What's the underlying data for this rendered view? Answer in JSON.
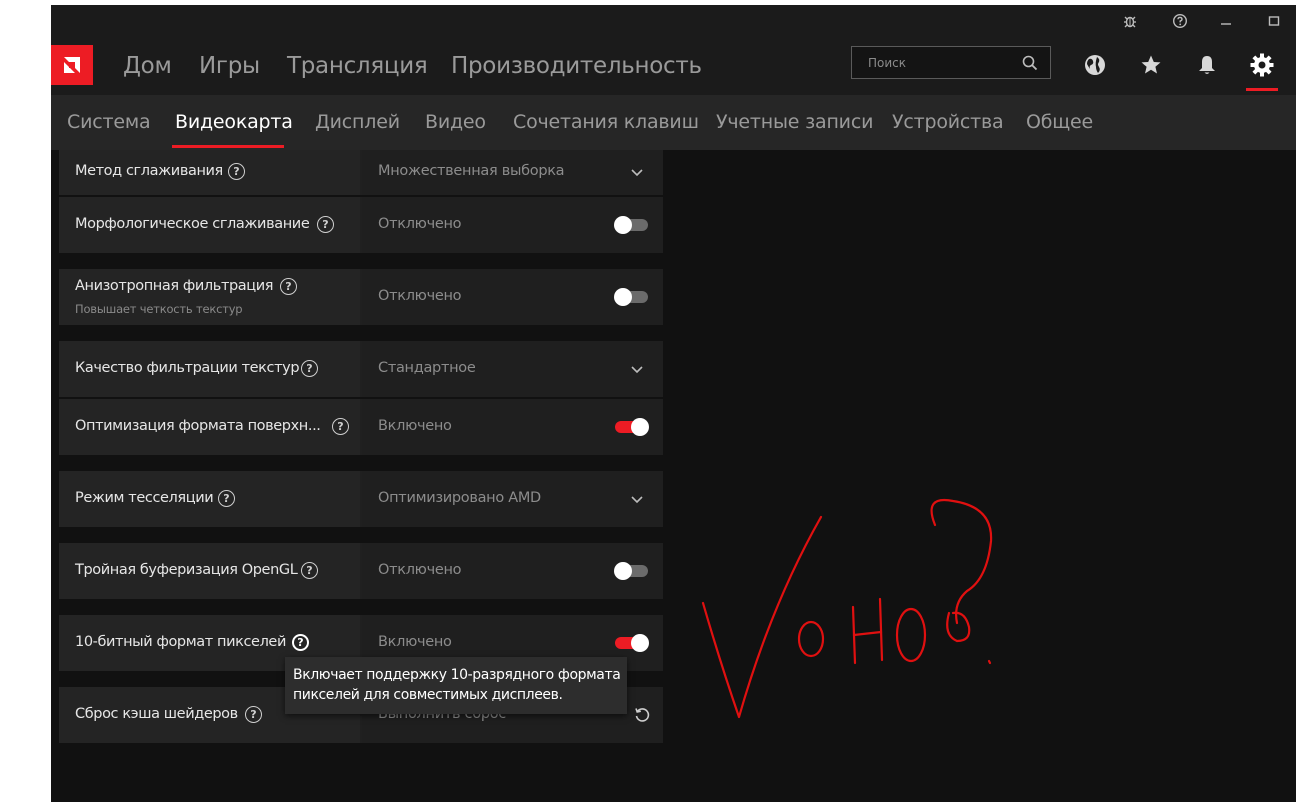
{
  "colors": {
    "accent": "#ed1c24",
    "background": "#111111",
    "row_label_bg": "#242424",
    "row_value_bg": "#1f1f1f",
    "scribble": "#e01010"
  },
  "titlebar": {
    "icons": [
      "bug-icon",
      "help-icon",
      "minimize-icon",
      "maximize-icon"
    ]
  },
  "mainnav": {
    "logo_icon": "amd-logo-icon",
    "items": [
      "Дом",
      "Игры",
      "Трансляция",
      "Производительность"
    ],
    "search_placeholder": "Поиск",
    "right_icons": [
      "globe-icon",
      "star-icon",
      "bell-icon",
      "gear-icon"
    ]
  },
  "subnav": {
    "items": [
      "Система",
      "Видеокарта",
      "Дисплей",
      "Видео",
      "Сочетания клавиш",
      "Учетные записи",
      "Устройства",
      "Общее"
    ],
    "active": "Видеокарта"
  },
  "settings": [
    {
      "label": "Метод сглаживания",
      "value": "Множественная выборка",
      "control": "dropdown"
    },
    {
      "label": "Морфологическое сглаживание",
      "value": "Отключено",
      "control": "toggle",
      "on": false
    },
    {
      "label": "Анизотропная фильтрация",
      "sublabel": "Повышает четкость текстур",
      "value": "Отключено",
      "control": "toggle",
      "on": false
    },
    {
      "label": "Качество фильтрации текстур",
      "value": "Стандартное",
      "control": "dropdown"
    },
    {
      "label": "Оптимизация формата поверхн...",
      "value": "Включено",
      "control": "toggle",
      "on": true
    },
    {
      "label": "Режим тесселяции",
      "value": "Оптимизировано AMD",
      "control": "dropdown"
    },
    {
      "label": "Тройная буферизация OpenGL",
      "value": "Отключено",
      "control": "toggle",
      "on": false
    },
    {
      "label": "10-битный формат пикселей",
      "value": "Включено",
      "control": "toggle",
      "on": true
    },
    {
      "label": "Сброс кэша шейдеров",
      "value": "Выполнить сброс",
      "control": "reset"
    }
  ],
  "tooltip": {
    "line1": "Включает поддержку 10-разрядного формата",
    "line2": "пикселей для совместимых дисплеев."
  },
  "annotation": {
    "text": "Vоно?"
  }
}
